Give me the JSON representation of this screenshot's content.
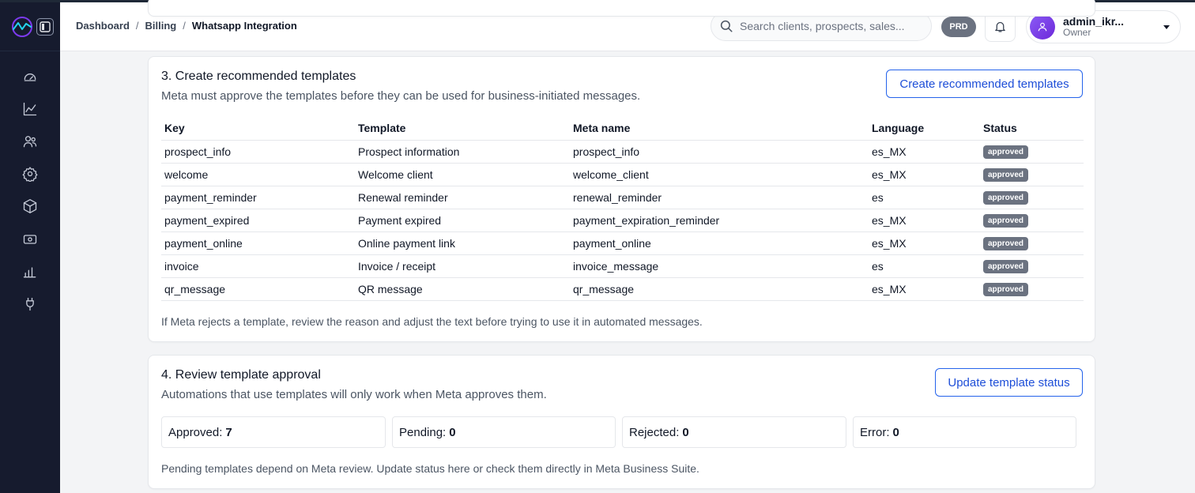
{
  "breadcrumb": [
    "Dashboard",
    "Billing",
    "Whatsapp Integration"
  ],
  "search": {
    "placeholder": "Search clients, prospects, sales..."
  },
  "environment_badge": "PRD",
  "user": {
    "name": "admin_ikr...",
    "role": "Owner"
  },
  "sidebar": {
    "icons": [
      "dashboard-gauge-icon",
      "chart-line-icon",
      "users-icon",
      "settings-gear-icon",
      "package-box-icon",
      "billing-cash-icon",
      "reports-bar-icon",
      "integration-plug-icon"
    ]
  },
  "section3": {
    "title": "3. Create recommended templates",
    "subtitle": "Meta must approve the templates before they can be used for business-initiated messages.",
    "button": "Create recommended templates",
    "columns": [
      "Key",
      "Template",
      "Meta name",
      "Language",
      "Status"
    ],
    "rows": [
      [
        "prospect_info",
        "Prospect information",
        "prospect_info",
        "es_MX",
        "approved"
      ],
      [
        "welcome",
        "Welcome client",
        "welcome_client",
        "es_MX",
        "approved"
      ],
      [
        "payment_reminder",
        "Renewal reminder",
        "renewal_reminder",
        "es",
        "approved"
      ],
      [
        "payment_expired",
        "Payment expired",
        "payment_expiration_reminder",
        "es_MX",
        "approved"
      ],
      [
        "payment_online",
        "Online payment link",
        "payment_online",
        "es_MX",
        "approved"
      ],
      [
        "invoice",
        "Invoice / receipt",
        "invoice_message",
        "es",
        "approved"
      ],
      [
        "qr_message",
        "QR message",
        "qr_message",
        "es_MX",
        "approved"
      ]
    ],
    "note": "If Meta rejects a template, review the reason and adjust the text before trying to use it in automated messages."
  },
  "section4": {
    "title": "4. Review template approval",
    "subtitle": "Automations that use templates will only work when Meta approves them.",
    "button": "Update template status",
    "stats": [
      {
        "label": "Approved:",
        "value": "7"
      },
      {
        "label": "Pending:",
        "value": "0"
      },
      {
        "label": "Rejected:",
        "value": "0"
      },
      {
        "label": "Error:",
        "value": "0"
      }
    ],
    "note": "Pending templates depend on Meta review. Update status here or check them directly in Meta Business Suite."
  },
  "colors": {
    "sidebar": "#161b2e",
    "accent": "#2563eb",
    "status_pill": "#6b7280",
    "avatar": "#7c3aed"
  }
}
